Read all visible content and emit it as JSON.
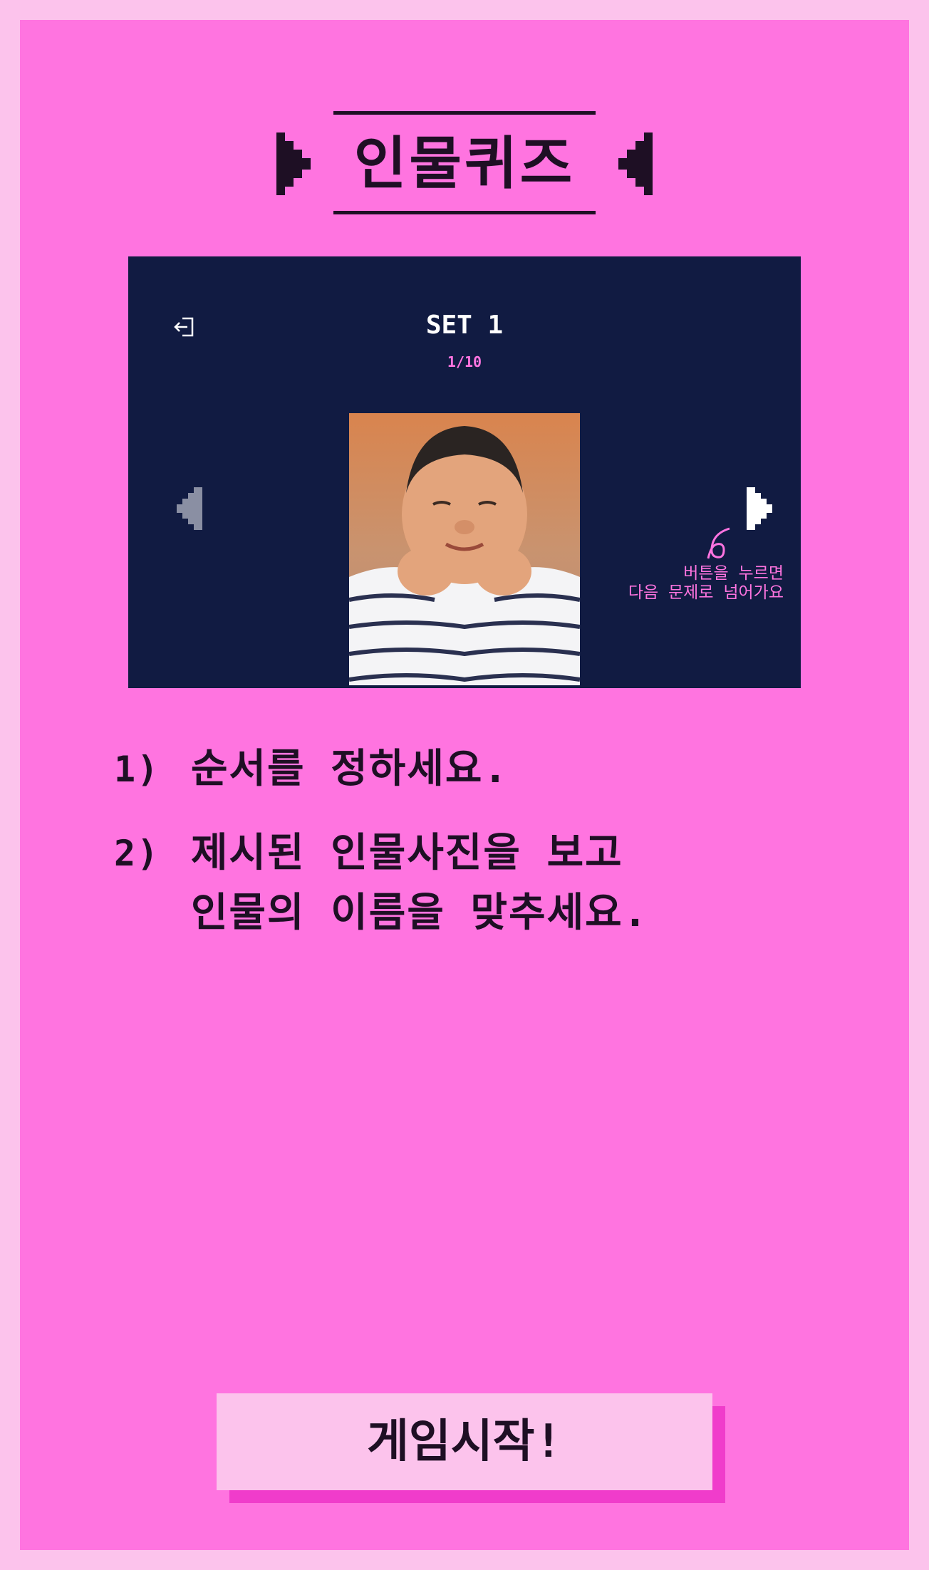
{
  "title": "인물퀴즈",
  "preview": {
    "set_title": "SET 1",
    "progress": "1/10",
    "hint_lines": [
      "버튼을 누르면",
      "다음 문제로 넘어가요"
    ]
  },
  "instructions": [
    {
      "number": "1)",
      "lines": [
        "순서를 정하세요."
      ]
    },
    {
      "number": "2)",
      "lines": [
        "제시된 인물사진을 보고",
        "인물의 이름을 맞추세요."
      ]
    }
  ],
  "start_button_label": "게임시작!",
  "icons": {
    "exit": "exit-icon",
    "prev": "arrow-left-icon",
    "next": "arrow-right-icon",
    "pointer": "curl-pointer-icon"
  },
  "colors": {
    "page_border": "#fcc3ec",
    "background": "#ff74e0",
    "panel": "#111b42",
    "text_dark": "#1e0f24",
    "button_shadow": "#f03ccb"
  }
}
